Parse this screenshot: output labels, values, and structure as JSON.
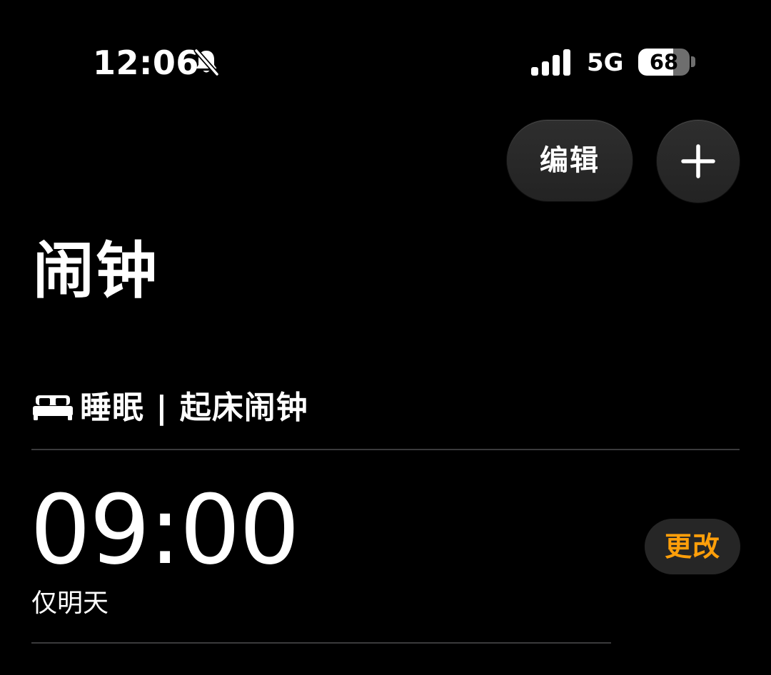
{
  "status_bar": {
    "time": "12:06",
    "silent_icon": "bell-slash-icon",
    "signal_icon": "cellular-signal-icon",
    "network": "5G",
    "battery_level": "68",
    "battery_fraction": 0.68
  },
  "toolbar": {
    "edit_label": "编辑",
    "add_icon": "plus-icon"
  },
  "page": {
    "title": "闹钟"
  },
  "sleep_section": {
    "icon": "bed-icon",
    "header": "睡眠 | 起床闹钟"
  },
  "alarm": {
    "time": "09:00",
    "repeat": "仅明天",
    "change_label": "更改",
    "accent_color": "#ff9f0a"
  },
  "colors": {
    "background": "#000000",
    "text": "#ffffff",
    "button_bg": "#262626",
    "accent": "#ff9f0a",
    "separator": "#3a3a3c"
  }
}
